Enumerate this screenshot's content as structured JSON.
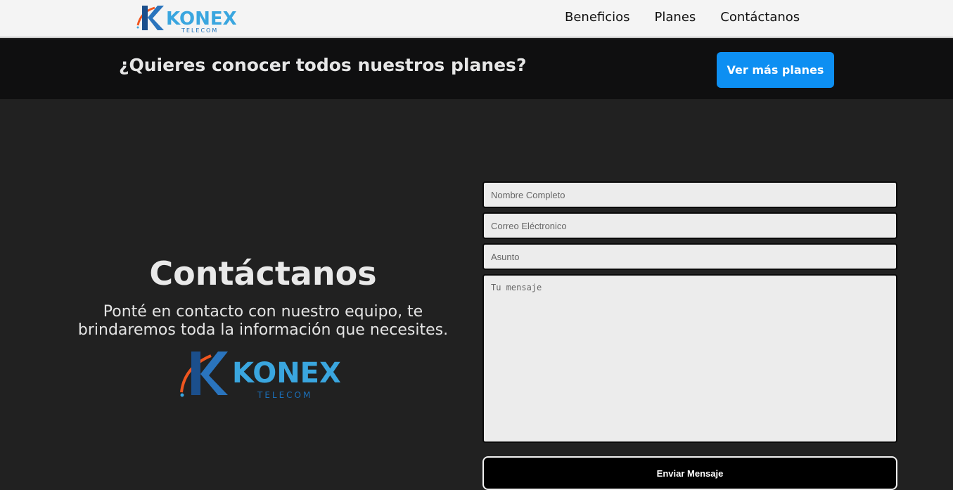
{
  "header": {
    "logo_text": "KONEX",
    "logo_sub": "TELECOM",
    "nav": [
      "Beneficios",
      "Planes",
      "Contáctanos"
    ]
  },
  "promo": {
    "text": "¿Quieres conocer todos nuestros planes?",
    "button_label": "Ver más planes"
  },
  "contact": {
    "title": "Contáctanos",
    "subtitle": "Ponté en contacto con nuestro equipo, te brindaremos toda la información que necesites.",
    "logo_text": "KONEX",
    "logo_sub": "TELECOM"
  },
  "form": {
    "name_placeholder": "Nombre Completo",
    "email_placeholder": "Correo Eléctronico",
    "subject_placeholder": "Asunto",
    "message_placeholder": "Tu mensaje",
    "submit_label": "Enviar Mensaje"
  },
  "colors": {
    "accent_blue": "#0d8ff2",
    "logo_light_blue": "#3aa6df",
    "logo_dark_blue": "#1b4f8c",
    "logo_orange": "#f0561f",
    "background": "#212121"
  }
}
